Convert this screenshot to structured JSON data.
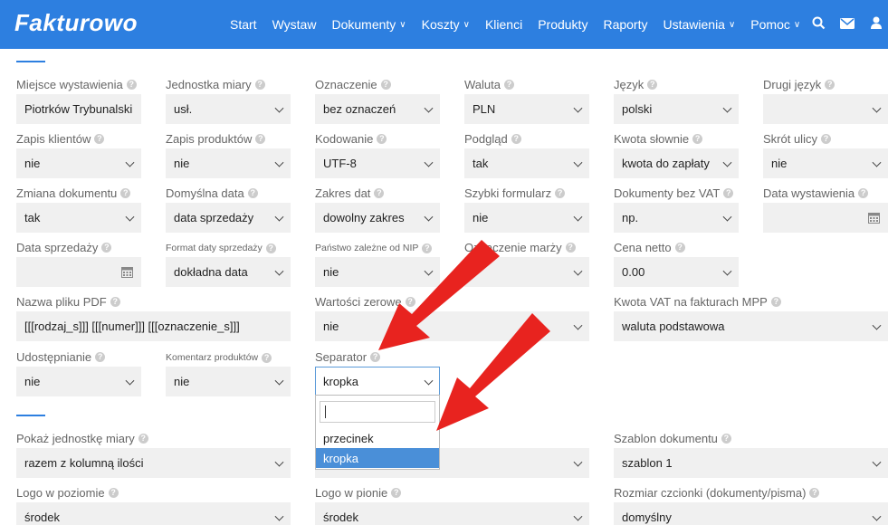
{
  "app": {
    "logo": "Fakturowo"
  },
  "nav": {
    "items": [
      {
        "label": "Start",
        "chev": ""
      },
      {
        "label": "Wystaw",
        "chev": ""
      },
      {
        "label": "Dokumenty",
        "chev": "∨"
      },
      {
        "label": "Koszty",
        "chev": "∨"
      },
      {
        "label": "Klienci",
        "chev": ""
      },
      {
        "label": "Produkty",
        "chev": ""
      },
      {
        "label": "Raporty",
        "chev": ""
      },
      {
        "label": "Ustawienia",
        "chev": "∨"
      },
      {
        "label": "Pomoc",
        "chev": "∨"
      }
    ],
    "icons": [
      "search-icon",
      "mail-icon",
      "user-icon"
    ]
  },
  "help_glyph": "?",
  "fields": {
    "miejsce": {
      "label": "Miejsce wystawienia",
      "value": "Piotrków Trybunalski"
    },
    "jednostka": {
      "label": "Jednostka miary",
      "value": "usł."
    },
    "oznaczenie": {
      "label": "Oznaczenie",
      "value": "bez oznaczeń"
    },
    "waluta": {
      "label": "Waluta",
      "value": "PLN"
    },
    "jezyk": {
      "label": "Język",
      "value": "polski"
    },
    "drugi_jezyk": {
      "label": "Drugi język",
      "value": ""
    },
    "zapis_klientow": {
      "label": "Zapis klientów",
      "value": "nie"
    },
    "zapis_produktow": {
      "label": "Zapis produktów",
      "value": "nie"
    },
    "kodowanie": {
      "label": "Kodowanie",
      "value": "UTF-8"
    },
    "podglad": {
      "label": "Podgląd",
      "value": "tak"
    },
    "kwota_slownie": {
      "label": "Kwota słownie",
      "value": "kwota do zapłaty"
    },
    "skrot_ulicy": {
      "label": "Skrót ulicy",
      "value": "nie"
    },
    "zmiana_dokumentu": {
      "label": "Zmiana dokumentu",
      "value": "tak"
    },
    "domyslna_data": {
      "label": "Domyślna data",
      "value": "data sprzedaży"
    },
    "zakres_dat": {
      "label": "Zakres dat",
      "value": "dowolny zakres"
    },
    "szybki_formularz": {
      "label": "Szybki formularz",
      "value": "nie"
    },
    "dokumenty_bez_vat": {
      "label": "Dokumenty bez VAT",
      "value": "np."
    },
    "data_wystawienia": {
      "label": "Data wystawienia",
      "value": ""
    },
    "data_sprzedazy": {
      "label": "Data sprzedaży",
      "value": ""
    },
    "format_daty": {
      "label": "Format daty sprzedaży",
      "value": "dokładna data"
    },
    "panstwo_nip": {
      "label": "Państwo zależne od NIP",
      "value": "nie"
    },
    "oznaczenie_marzy": {
      "label": "Oznaczenie marży",
      "value": ""
    },
    "cena_netto": {
      "label": "Cena netto",
      "value": "0.00"
    },
    "nazwa_pdf": {
      "label": "Nazwa pliku PDF",
      "value": "[[[rodzaj_s]]] [[[numer]]] [[[oznaczenie_s]]]"
    },
    "wartosci_zerowe": {
      "label": "Wartości zerowe",
      "value": "nie"
    },
    "kwota_vat_mpp": {
      "label": "Kwota VAT na fakturach MPP",
      "value": "waluta podstawowa"
    },
    "udostepnianie": {
      "label": "Udostępnianie",
      "value": "nie"
    },
    "komentarz_produktow": {
      "label": "Komentarz produktów",
      "value": "nie"
    },
    "separator": {
      "label": "Separator",
      "value": "kropka"
    },
    "pokaz_jednostke": {
      "label": "Pokaż jednostkę miary",
      "value": "razem z kolumną ilości"
    },
    "hidden_mid": {
      "value": ""
    },
    "szablon": {
      "label": "Szablon dokumentu",
      "value": "szablon 1"
    },
    "logo_poziome": {
      "label": "Logo w poziomie",
      "value": "środek"
    },
    "logo_pionie": {
      "label": "Logo w pionie",
      "value": "środek"
    },
    "rozmiar_czcionki": {
      "label": "Rozmiar czcionki (dokumenty/pisma)",
      "value": "domyślny"
    }
  },
  "separator_dropdown": {
    "search_value": "",
    "options": [
      "przecinek",
      "kropka"
    ],
    "selected": "kropka"
  },
  "annotation_color": "#e8231f"
}
